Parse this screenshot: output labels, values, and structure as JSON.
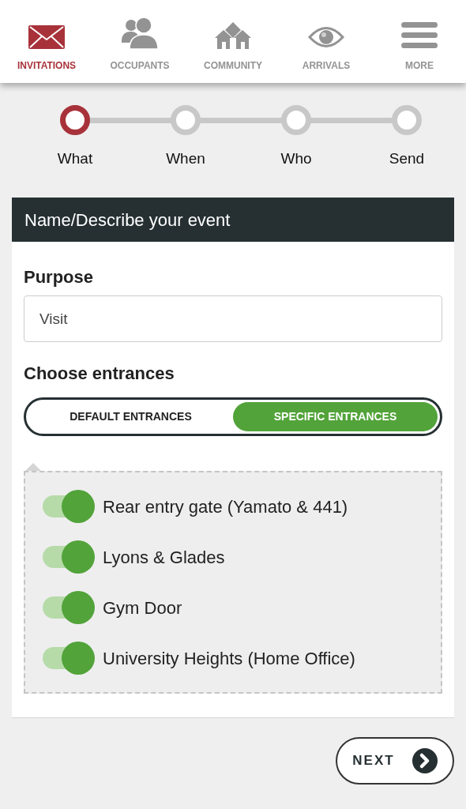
{
  "nav": [
    {
      "label": "INVITATIONS",
      "kind": "envelope",
      "selected": true
    },
    {
      "label": "OCCUPANTS",
      "kind": "people",
      "selected": false
    },
    {
      "label": "COMMUNITY",
      "kind": "houses",
      "selected": false
    },
    {
      "label": "ARRIVALS",
      "kind": "eye",
      "selected": false
    },
    {
      "label": "MORE",
      "kind": "menu",
      "selected": false
    }
  ],
  "steps": [
    {
      "label": "What",
      "selected": true
    },
    {
      "label": "When",
      "selected": false
    },
    {
      "label": "Who",
      "selected": false
    },
    {
      "label": "Send",
      "selected": false
    }
  ],
  "card": {
    "title": "Name/Describe your event",
    "purpose": {
      "label": "Purpose",
      "value": "Visit"
    },
    "entrances": {
      "label": "Choose entrances",
      "options": [
        {
          "label": "DEFAULT ENTRANCES",
          "selected": false
        },
        {
          "label": "SPECIFIC ENTRANCES",
          "selected": true
        }
      ],
      "items": [
        {
          "name": "Rear entry gate (Yamato & 441)",
          "on": true
        },
        {
          "name": "Lyons & Glades",
          "on": true
        },
        {
          "name": "Gym Door",
          "on": true
        },
        {
          "name": "University Heights (Home Office)",
          "on": true
        }
      ]
    }
  },
  "next_button": "NEXT"
}
